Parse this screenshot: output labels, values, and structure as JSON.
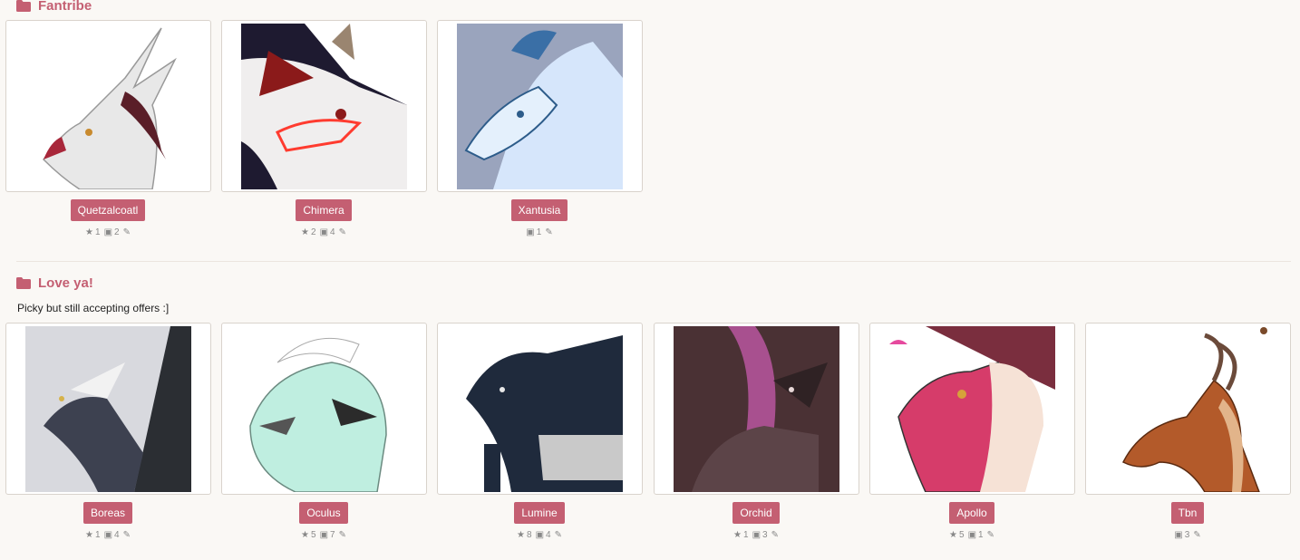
{
  "folders": [
    {
      "title": "Fantribe",
      "description": "",
      "characters": [
        {
          "name": "Quetzalcoatl",
          "stars": "1",
          "images": "2",
          "art": "quetzalcoatl"
        },
        {
          "name": "Chimera",
          "stars": "2",
          "images": "4",
          "art": "chimera"
        },
        {
          "name": "Xantusia",
          "stars": "",
          "images": "1",
          "art": "xantusia"
        }
      ]
    },
    {
      "title": "Love ya!",
      "description": "Picky but still accepting offers :]",
      "characters": [
        {
          "name": "Boreas",
          "stars": "1",
          "images": "4",
          "art": "boreas"
        },
        {
          "name": "Oculus",
          "stars": "5",
          "images": "7",
          "art": "oculus"
        },
        {
          "name": "Lumine",
          "stars": "8",
          "images": "4",
          "art": "lumine"
        },
        {
          "name": "Orchid",
          "stars": "1",
          "images": "3",
          "art": "orchid"
        },
        {
          "name": "Apollo",
          "stars": "5",
          "images": "1",
          "art": "apollo"
        },
        {
          "name": "Tbn",
          "stars": "",
          "images": "3",
          "art": "tbn"
        }
      ]
    }
  ],
  "colors": {
    "accent": "#c45f72",
    "background": "#faf8f5"
  },
  "icons": {
    "folder": "folder-icon",
    "star": "star-icon",
    "image": "image-icon",
    "edit": "pencil-icon"
  }
}
